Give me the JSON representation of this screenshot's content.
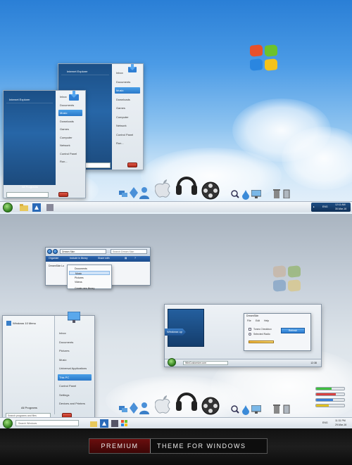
{
  "top": {
    "menu_back": {
      "pinned": "Internet Explorer",
      "items": [
        "Inbox",
        "Documents",
        "Music",
        "Downloads",
        "Games",
        "Computer",
        "Network",
        "Control Panel",
        "Run..."
      ],
      "highlight_index": 2
    },
    "menu_front": {
      "pinned": "Internet Explorer",
      "items": [
        "Inbox",
        "Documents",
        "Music",
        "Downloads",
        "Games",
        "Computer",
        "Network",
        "Control Panel",
        "Run..."
      ],
      "highlight_index": 2,
      "all_programs": "All Programs"
    },
    "tray": {
      "lang": "ENG",
      "time": "12:11 AM",
      "date": "30-Mar-16"
    }
  },
  "bottom": {
    "explorer": {
      "address": "Dream Skin",
      "search_placeholder": "Search Dream Skin",
      "commands": [
        "Organize",
        "Include in library",
        "Share with",
        "New folder"
      ],
      "left_item": "DreamSkin Lo"
    },
    "library_menu": {
      "items": [
        "Documents",
        "Music",
        "Pictures",
        "Videos",
        "Create new library"
      ],
      "highlight_index": 1
    },
    "vista_window": {
      "badge": "Windows up",
      "dialog_title": "DreamSkin",
      "menus": [
        "File",
        "Edit",
        "Help"
      ],
      "checkbox1": "Tones Checkbox",
      "checkbox2": "Selected Radio",
      "button": "Refresh",
      "taskbar_item": "WinCustomize.com",
      "time": "12:38"
    },
    "start_menu": {
      "title": "Windows 10 Menu",
      "items": [
        "Inbox",
        "Documents",
        "Pictures",
        "Music",
        "Universal Applications",
        "This PC",
        "Control Panel",
        "Settings",
        "Devices and Printers"
      ],
      "highlight_index": 5,
      "all_programs": "All Programs",
      "search_placeholder": "Search programs and files"
    },
    "taskbar": {
      "search": "Search Windows",
      "lang": "ENG",
      "time": "11:31 PM",
      "date": "29-Mar-16"
    },
    "progress_colors": [
      "#3fbf3f",
      "#d84040",
      "#3a7fd8",
      "#e0c020"
    ],
    "progress_values": [
      0.55,
      0.7,
      0.6,
      0.45
    ]
  },
  "banner": {
    "left": "PREMIUM",
    "right": "THEME FOR WINDOWS"
  }
}
